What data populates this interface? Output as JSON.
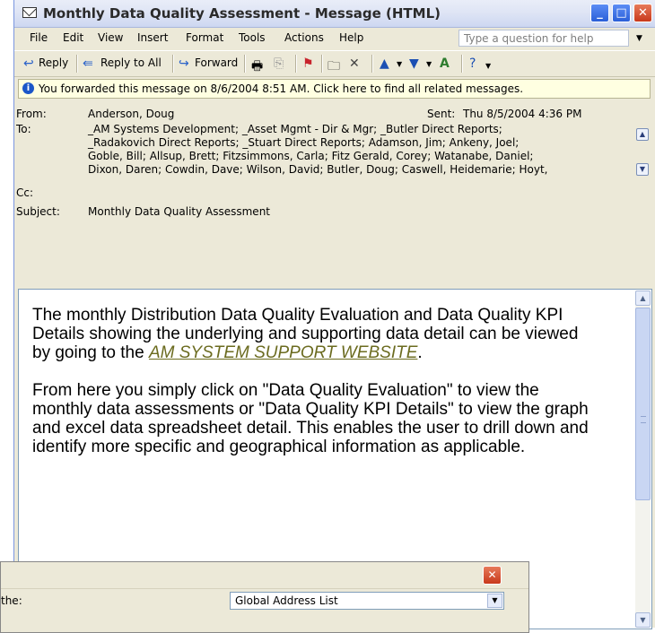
{
  "window": {
    "title": "Monthly Data Quality Assessment - Message (HTML)",
    "min_label": "_",
    "max_label": "□",
    "close_label": "✕"
  },
  "menu": {
    "items": [
      "File",
      "Edit",
      "View",
      "Insert",
      "Format",
      "Tools",
      "Actions",
      "Help"
    ],
    "help_placeholder": "Type a question for help"
  },
  "toolbar": {
    "reply": "Reply",
    "reply_all": "Reply to All",
    "forward": "Forward"
  },
  "infobar": {
    "text": "You forwarded this message on 8/6/2004 8:51 AM. Click here to find all related messages."
  },
  "header": {
    "from_label": "From:",
    "from_value": "Anderson, Doug",
    "sent_label": "Sent:",
    "sent_value": "Thu 8/5/2004 4:36 PM",
    "to_label": "To:",
    "to_lines": [
      "_AM Systems Development; _Asset Mgmt - Dir & Mgr; _Butler Direct Reports;",
      "_Radakovich Direct Reports; _Stuart Direct Reports; Adamson, Jim; Ankeny, Joel;",
      "Goble, Bill; Allsup, Brett; Fitzsimmons, Carla; Fitz Gerald, Corey; Watanabe, Daniel;",
      "Dixon, Daren; Cowdin, Dave; Wilson, David; Butler, Doug; Caswell, Heidemarie; Hoyt,"
    ],
    "cc_label": "Cc:",
    "subject_label": "Subject:",
    "subject_value": "Monthly Data Quality Assessment"
  },
  "body": {
    "p1_before": "The monthly  Distribution Data Quality Evaluation and Data Quality KPI Details showing the underlying and supporting data detail can be viewed by going to the ",
    "p1_link": "AM SYSTEM SUPPORT WEBSITE",
    "p1_after": ".",
    "p2": "From here you simply click on \"Data Quality Evaluation\" to view the monthly data assessments or \"Data Quality KPI Details\" to view the  graph and excel data spreadsheet detail. This enables the user to drill down and identify more specific and geographical information as applicable."
  },
  "dialog": {
    "label": "the:",
    "select_value": "Global Address List"
  },
  "colors": {
    "window_bg": "#ECE9D8",
    "infobar_bg": "#ffffe1",
    "link": "#6b6b1f",
    "close_red": "#c8391c"
  }
}
